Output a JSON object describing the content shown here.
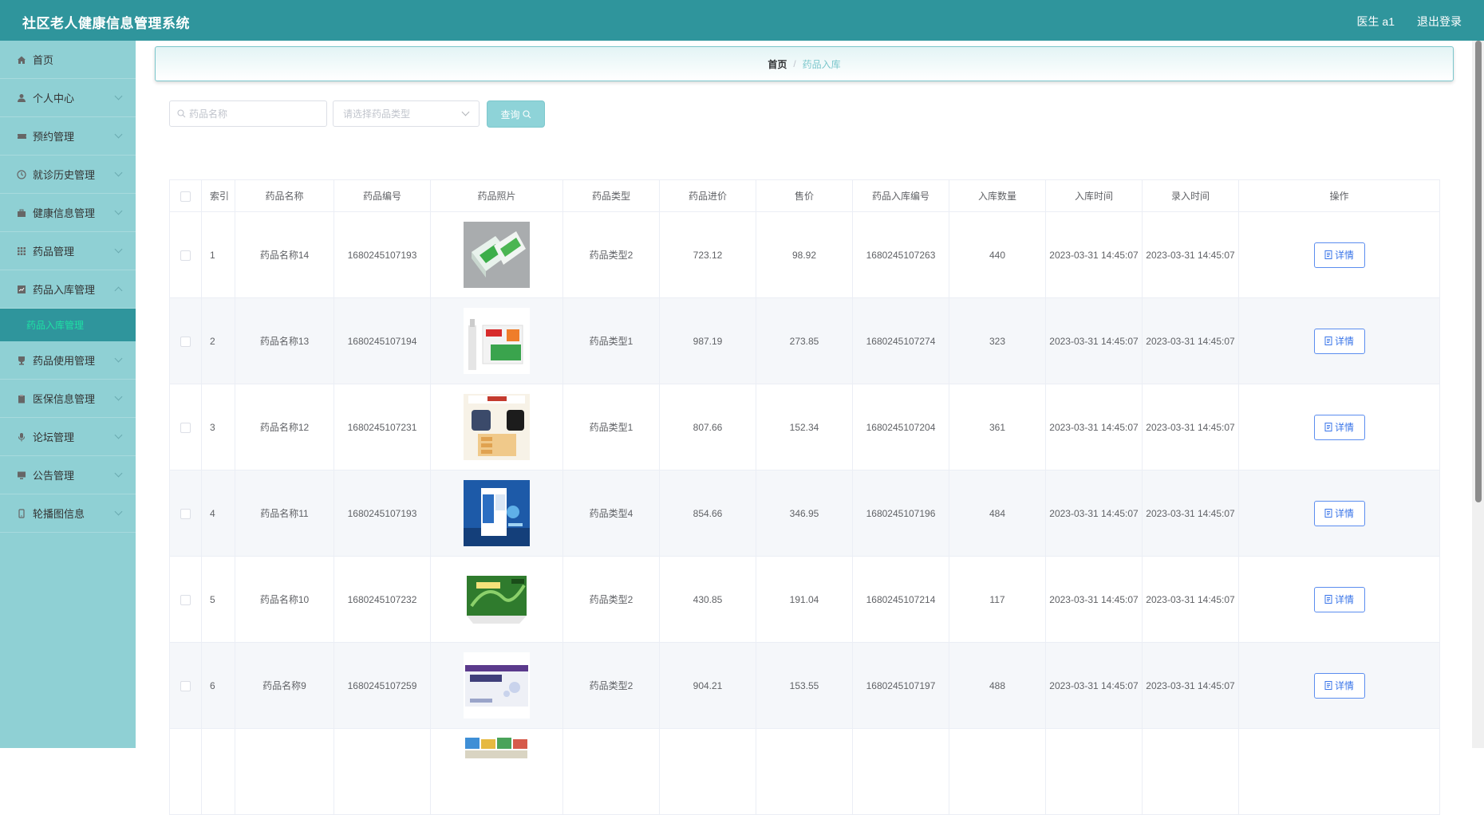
{
  "app": {
    "title": "社区老人健康信息管理系统",
    "user": "医生 a1",
    "logout": "退出登录"
  },
  "sidebar": {
    "items": [
      {
        "label": "首页",
        "icon": "home-icon",
        "expandable": false
      },
      {
        "label": "个人中心",
        "icon": "user-icon",
        "expandable": true
      },
      {
        "label": "预约管理",
        "icon": "ticket-icon",
        "expandable": true
      },
      {
        "label": "就诊历史管理",
        "icon": "clock-icon",
        "expandable": true
      },
      {
        "label": "健康信息管理",
        "icon": "briefcase-icon",
        "expandable": true
      },
      {
        "label": "药品管理",
        "icon": "grid-icon",
        "expandable": true
      },
      {
        "label": "药品入库管理",
        "icon": "chart-icon",
        "expandable": true,
        "expanded": true
      },
      {
        "label": "药品使用管理",
        "icon": "cup-icon",
        "expandable": true
      },
      {
        "label": "医保信息管理",
        "icon": "clipboard-icon",
        "expandable": true
      },
      {
        "label": "论坛管理",
        "icon": "microphone-icon",
        "expandable": true
      },
      {
        "label": "公告管理",
        "icon": "monitor-icon",
        "expandable": true
      },
      {
        "label": "轮播图信息",
        "icon": "phone-icon",
        "expandable": true
      }
    ],
    "submenu": {
      "label": "药品入库管理"
    }
  },
  "breadcrumb": {
    "home": "首页",
    "separator": "/",
    "current": "药品入库"
  },
  "search": {
    "name_placeholder": "药品名称",
    "type_placeholder": "请选择药品类型",
    "query_label": "查询"
  },
  "table": {
    "headers": [
      "索引",
      "药品名称",
      "药品编号",
      "药品照片",
      "药品类型",
      "药品进价",
      "售价",
      "药品入库编号",
      "入库数量",
      "入库时间",
      "录入时间",
      "操作"
    ],
    "detail_label": "详情",
    "rows": [
      {
        "index": "1",
        "name": "药品名称14",
        "code": "1680245107193",
        "type": "药品类型2",
        "cost": "723.12",
        "price": "98.92",
        "in_code": "1680245107263",
        "qty": "440",
        "in_time": "2023-03-31 14:45:07",
        "entry_time": "2023-03-31 14:45:07"
      },
      {
        "index": "2",
        "name": "药品名称13",
        "code": "1680245107194",
        "type": "药品类型1",
        "cost": "987.19",
        "price": "273.85",
        "in_code": "1680245107274",
        "qty": "323",
        "in_time": "2023-03-31 14:45:07",
        "entry_time": "2023-03-31 14:45:07"
      },
      {
        "index": "3",
        "name": "药品名称12",
        "code": "1680245107231",
        "type": "药品类型1",
        "cost": "807.66",
        "price": "152.34",
        "in_code": "1680245107204",
        "qty": "361",
        "in_time": "2023-03-31 14:45:07",
        "entry_time": "2023-03-31 14:45:07"
      },
      {
        "index": "4",
        "name": "药品名称11",
        "code": "1680245107193",
        "type": "药品类型4",
        "cost": "854.66",
        "price": "346.95",
        "in_code": "1680245107196",
        "qty": "484",
        "in_time": "2023-03-31 14:45:07",
        "entry_time": "2023-03-31 14:45:07"
      },
      {
        "index": "5",
        "name": "药品名称10",
        "code": "1680245107232",
        "type": "药品类型2",
        "cost": "430.85",
        "price": "191.04",
        "in_code": "1680245107214",
        "qty": "117",
        "in_time": "2023-03-31 14:45:07",
        "entry_time": "2023-03-31 14:45:07"
      },
      {
        "index": "6",
        "name": "药品名称9",
        "code": "1680245107259",
        "type": "药品类型2",
        "cost": "904.21",
        "price": "153.55",
        "in_code": "1680245107197",
        "qty": "488",
        "in_time": "2023-03-31 14:45:07",
        "entry_time": "2023-03-31 14:45:07"
      },
      {
        "index": "",
        "name": "",
        "code": "",
        "type": "",
        "cost": "",
        "price": "",
        "in_code": "",
        "qty": "",
        "in_time": "",
        "entry_time": ""
      }
    ]
  },
  "colors": {
    "header": "#2f959c",
    "sidebar": "#8fd0d4",
    "accent": "#8ed3d8",
    "active_sub": "#1fe0a4",
    "detail_btn": "#3a75e8"
  }
}
